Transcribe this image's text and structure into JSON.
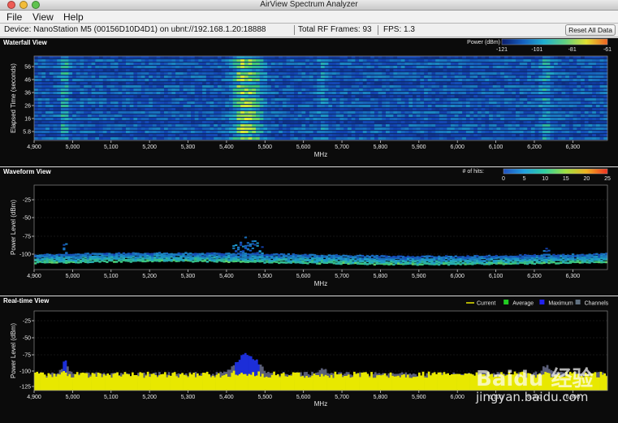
{
  "window": {
    "title": "AirView Spectrum Analyzer"
  },
  "menu": {
    "file": "File",
    "view": "View",
    "help": "Help"
  },
  "status": {
    "device": "Device: NanoStation M5 (00156D10D4D1) on ubnt://192.168.1.20:18888",
    "frames": "Total RF Frames: 93",
    "fps": "FPS: 1.3",
    "reset_label": "Reset All Data"
  },
  "waterfall": {
    "title": "Waterfall View",
    "ylabel": "Elapsed Time (seconds)",
    "yticks": [
      "56",
      "46",
      "36",
      "26",
      "16",
      "5.8"
    ],
    "legend_title": "Power (dBm)",
    "legend_ticks": [
      "-121",
      "-101",
      "-81",
      "-61"
    ]
  },
  "waveform": {
    "title": "Waveform View",
    "ylabel": "Power Level (dBm)",
    "yticks": [
      "-25",
      "-50",
      "-75",
      "-100"
    ],
    "legend_title": "# of hits:",
    "legend_ticks": [
      "0",
      "5",
      "10",
      "15",
      "20",
      "25"
    ]
  },
  "realtime": {
    "title": "Real-time View",
    "ylabel": "Power Level (dBm)",
    "yticks": [
      "-25",
      "-50",
      "-75",
      "-100",
      "-125"
    ],
    "legend": [
      {
        "label": "Current",
        "color": "#e8e800"
      },
      {
        "label": "Average",
        "color": "#22cc22"
      },
      {
        "label": "Maximum",
        "color": "#2222ee"
      },
      {
        "label": "Channels",
        "color": "#607080"
      }
    ]
  },
  "xaxis": {
    "label": "MHz",
    "ticks": [
      "4,900",
      "5,000",
      "5,100",
      "5,200",
      "5,300",
      "5,400",
      "5,500",
      "5,600",
      "5,700",
      "5,800",
      "5,900",
      "6,000",
      "6,100",
      "6,200",
      "6,300"
    ]
  },
  "colors": {
    "plot_bg": "#0b0b0b",
    "chrome": "#dcdcdc",
    "accent": "#e8e800"
  },
  "watermark": {
    "brand": "Baidu 经验",
    "url": "jingyan.baidu.com"
  }
}
